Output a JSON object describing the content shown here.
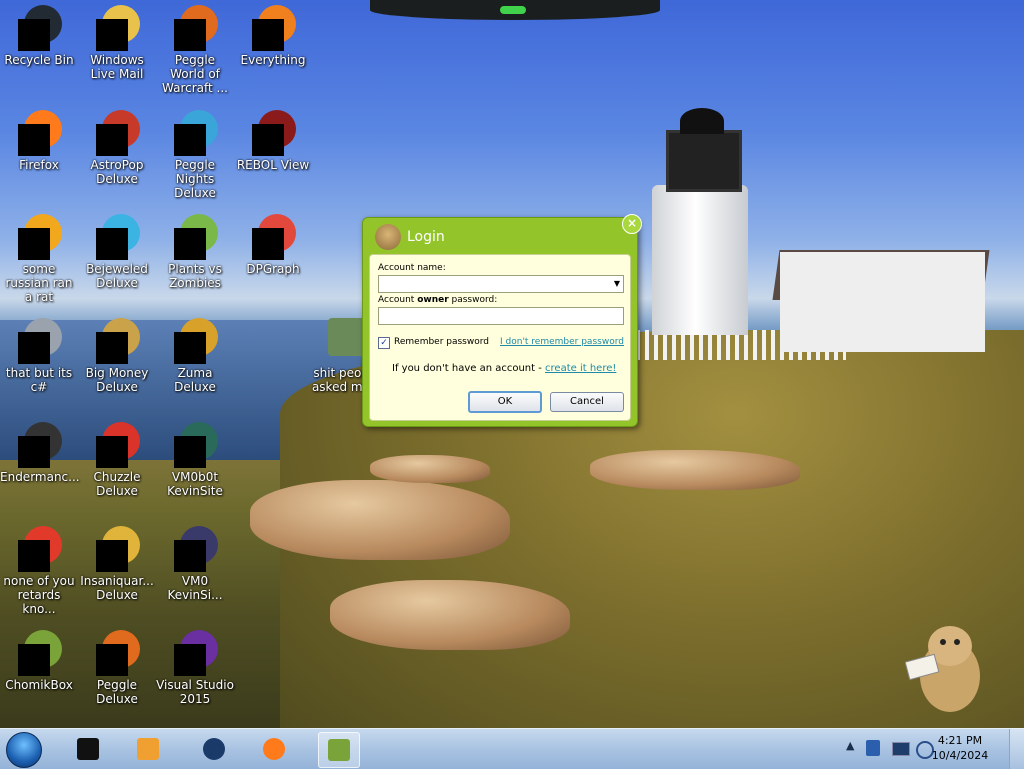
{
  "desktop_icons": [
    {
      "label": "Recycle Bin",
      "icon": "recycle-bin-icon",
      "color": "#222a33"
    },
    {
      "label": "Windows Live Mail",
      "icon": "mail-icon",
      "color": "#e8c24a"
    },
    {
      "label": "Peggle World of Warcraft ...",
      "icon": "peggle-wow-icon",
      "color": "#e06a1d"
    },
    {
      "label": "Everything",
      "icon": "everything-icon",
      "color": "#f0801e"
    },
    {
      "label": "Firefox",
      "icon": "firefox-icon",
      "color": "#ff7a1a"
    },
    {
      "label": "AstroPop Deluxe",
      "icon": "astropop-icon",
      "color": "#c73a2a"
    },
    {
      "label": "Peggle Nights Deluxe",
      "icon": "peggle-nights-icon",
      "color": "#3aa5d9"
    },
    {
      "label": "REBOL View",
      "icon": "rebol-icon",
      "color": "#8b1a1a"
    },
    {
      "label": "some russian ran a rat",
      "icon": "rat-icon",
      "color": "#f2a81c"
    },
    {
      "label": "Bejeweled Deluxe",
      "icon": "bejeweled-icon",
      "color": "#3bb3e3"
    },
    {
      "label": "Plants vs Zombies",
      "icon": "pvz-icon",
      "color": "#7ab84a"
    },
    {
      "label": "DPGraph",
      "icon": "dpgraph-icon",
      "color": "#e2483c"
    },
    {
      "label": "that but its c#",
      "icon": "stack-icon",
      "color": "#9aa2ad"
    },
    {
      "label": "Big Money Deluxe",
      "icon": "money-bag-icon",
      "color": "#c9a24a"
    },
    {
      "label": "Zuma Deluxe",
      "icon": "zuma-icon",
      "color": "#d8a12a"
    },
    {
      "label": "shit peo... asked m...",
      "icon": "folder-icon",
      "color": "#6b8a5a"
    },
    {
      "label": "Endermanc...",
      "icon": "terminal-icon",
      "color": "#333333"
    },
    {
      "label": "Chuzzle Deluxe",
      "icon": "chuzzle-icon",
      "color": "#d9332a"
    },
    {
      "label": "VM0b0t KevinSite",
      "icon": "vm-icon",
      "color": "#2a6a5a"
    },
    {
      "label": "none of you retards kno...",
      "icon": "chrome-like-icon",
      "color": "#e23a2a"
    },
    {
      "label": "Insaniquar... Deluxe",
      "icon": "insaniquarium-icon",
      "color": "#e0b43a"
    },
    {
      "label": "VM0 KevinSi...",
      "icon": "vm-icon",
      "color": "#3a3a6a"
    },
    {
      "label": "ChomikBox",
      "icon": "chomikbox-icon",
      "color": "#7aa43a"
    },
    {
      "label": "Peggle Deluxe",
      "icon": "peggle-icon",
      "color": "#e06a1d"
    },
    {
      "label": "Visual Studio 2015",
      "icon": "visual-studio-icon",
      "color": "#6a2fa0"
    }
  ],
  "dialog": {
    "title": "Login",
    "account_name_label": "Account name:",
    "account_name_value": "",
    "password_label_pre": "Account ",
    "password_label_bold": "owner",
    "password_label_post": " password:",
    "password_value": "",
    "remember_label": "Remember password",
    "remember_checked": "✓",
    "forgot_link": "I don't remember password",
    "no_account_text": "If you don't have an account - ",
    "create_link": "create it here!",
    "ok_label": "OK",
    "cancel_label": "Cancel",
    "close_glyph": "×"
  },
  "taskbar": {
    "items": [
      {
        "icon": "terminal-icon"
      },
      {
        "icon": "media-player-icon"
      },
      {
        "icon": "globe-icon"
      },
      {
        "icon": "firefox-icon"
      },
      {
        "icon": "chomikbox-icon",
        "active": true
      }
    ],
    "tray": {
      "show_hidden_glyph": "▲"
    },
    "clock_time": "4:21 PM",
    "clock_date": "10/4/2024"
  }
}
